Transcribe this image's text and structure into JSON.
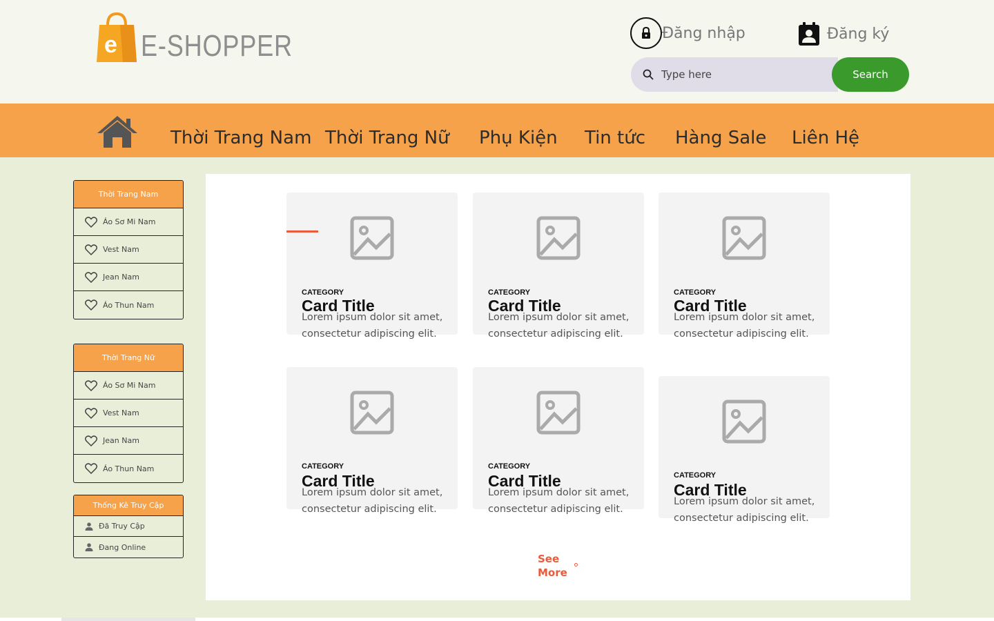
{
  "header": {
    "logo_text": "E-SHOPPER",
    "logo_bag_letter": "e",
    "login_label": "Đăng nhập",
    "register_label": "Đăng ký",
    "search_placeholder": "Type here",
    "search_button": "Search"
  },
  "nav": {
    "items": [
      {
        "label": "Thời Trang Nam"
      },
      {
        "label": "Thời Trang Nữ"
      },
      {
        "label": "Phụ Kiện"
      },
      {
        "label": "Tin tức"
      },
      {
        "label": "Hàng Sale"
      },
      {
        "label": "Liên Hệ"
      }
    ]
  },
  "sidebar": {
    "men": {
      "title": "Thời Trang Nam",
      "items": [
        "Áo Sơ Mi Nam",
        "Vest Nam",
        "Jean Nam",
        "Áo Thun Nam"
      ]
    },
    "women": {
      "title": "Thời Trang Nữ",
      "items": [
        "Áo Sơ Mi Nam",
        "Vest Nam",
        "Jean Nam",
        "Áo Thun Nam"
      ]
    },
    "stats": {
      "title": "Thống Kê Truy Cập",
      "items": [
        "Đã Truy Cập",
        "Đang Online"
      ]
    }
  },
  "cards": [
    {
      "category": "CATEGORY",
      "title": "Card Title",
      "desc": "Lorem ipsum dolor sit amet, consectetur adipiscing elit."
    },
    {
      "category": "CATEGORY",
      "title": "Card Title",
      "desc": "Lorem ipsum dolor sit amet, consectetur adipiscing elit."
    },
    {
      "category": "CATEGORY",
      "title": "Card Title",
      "desc": "Lorem ipsum dolor sit amet, consectetur adipiscing elit."
    },
    {
      "category": "CATEGORY",
      "title": "Card Title",
      "desc": "Lorem ipsum dolor sit amet, consectetur adipiscing elit."
    },
    {
      "category": "CATEGORY",
      "title": "Card Title",
      "desc": "Lorem ipsum dolor sit amet, consectetur adipiscing elit."
    },
    {
      "category": "CATEGORY",
      "title": "Card Title",
      "desc": "Lorem ipsum dolor sit amet, consectetur adipiscing elit."
    }
  ],
  "see_more": "See More",
  "colors": {
    "accent_orange": "#f5a24b",
    "search_green": "#3a9b2c",
    "link_red": "#ea5b3a"
  }
}
